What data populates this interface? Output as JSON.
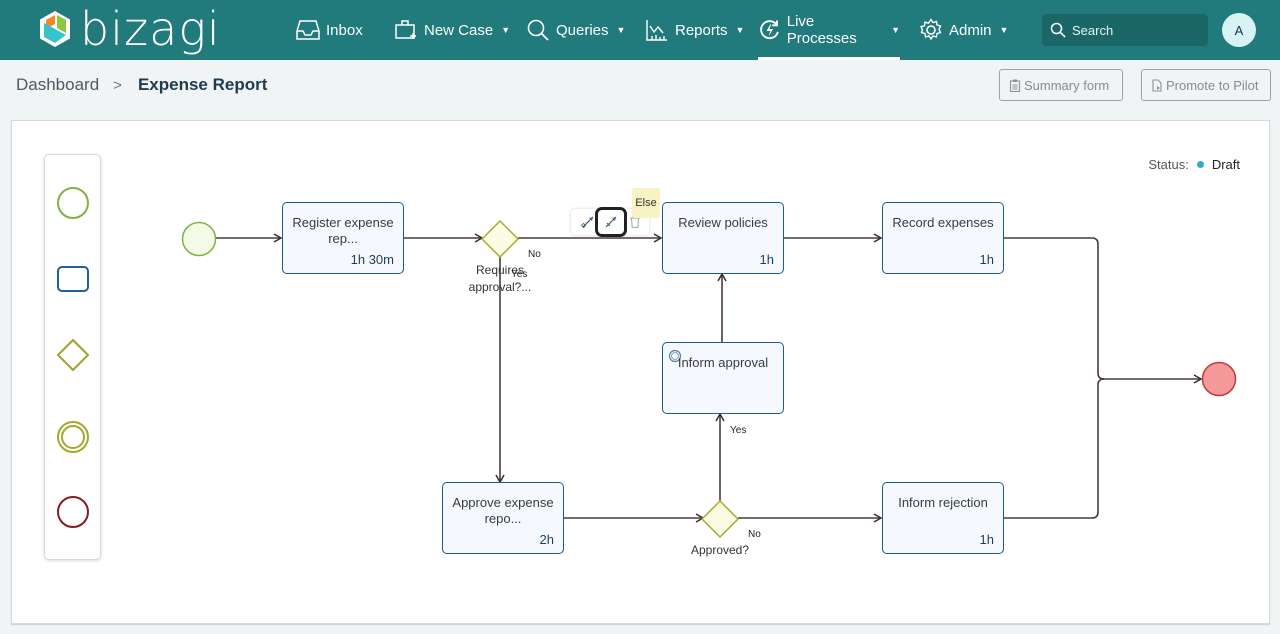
{
  "app": {
    "brand": "bizagi",
    "colors": {
      "topbar": "#217a7b",
      "accent": "#35a6d6",
      "start_event": "#7cb342",
      "end_event": "#f4999a",
      "gateway": "#b5b834"
    }
  },
  "nav": {
    "items": [
      {
        "label": "Inbox",
        "icon": "inbox-icon",
        "dropdown": false
      },
      {
        "label": "New Case",
        "icon": "new-case-icon",
        "dropdown": true
      },
      {
        "label": "Queries",
        "icon": "search-icon",
        "dropdown": true
      },
      {
        "label": "Reports",
        "icon": "chart-icon",
        "dropdown": true
      },
      {
        "label": "Live Processes",
        "icon": "live-process-icon",
        "dropdown": true,
        "active": true
      },
      {
        "label": "Admin",
        "icon": "gear-icon",
        "dropdown": true
      }
    ],
    "search_placeholder": "Search",
    "avatar_initial": "A"
  },
  "breadcrumb": {
    "parent": "Dashboard",
    "separator": ">",
    "current": "Expense Report"
  },
  "actions": {
    "summary_form": "Summary form",
    "promote_to_pilot": "Promote to Pilot"
  },
  "status": {
    "label": "Status:",
    "value": "Draft"
  },
  "palette": {
    "items": [
      {
        "name": "start-event",
        "icon": "start-event-icon"
      },
      {
        "name": "task",
        "icon": "task-icon"
      },
      {
        "name": "gateway",
        "icon": "gateway-icon"
      },
      {
        "name": "intermediate-event",
        "icon": "intermediate-event-icon"
      },
      {
        "name": "end-event",
        "icon": "end-event-icon"
      }
    ]
  },
  "diagram": {
    "tasks": [
      {
        "name": "Register expense rep...",
        "duration": "1h 30m"
      },
      {
        "name": "Review policies",
        "duration": "1h"
      },
      {
        "name": "Record expenses",
        "duration": "1h"
      },
      {
        "name": "Inform approval",
        "duration": ""
      },
      {
        "name": "Approve expense repo...",
        "duration": "2h"
      },
      {
        "name": "Inform rejection",
        "duration": "1h"
      }
    ],
    "gateways": [
      {
        "label": "Requires approval?..."
      },
      {
        "label": "Approved?"
      }
    ],
    "flow_labels": {
      "g1_no": "No",
      "g1_yes": "Yes",
      "g2_yes": "Yes",
      "g2_no": "No"
    },
    "edge_toolbar": {
      "tooltip": "Else",
      "tools": [
        "conditional-flow-icon",
        "default-flow-icon",
        "delete-icon"
      ]
    }
  }
}
